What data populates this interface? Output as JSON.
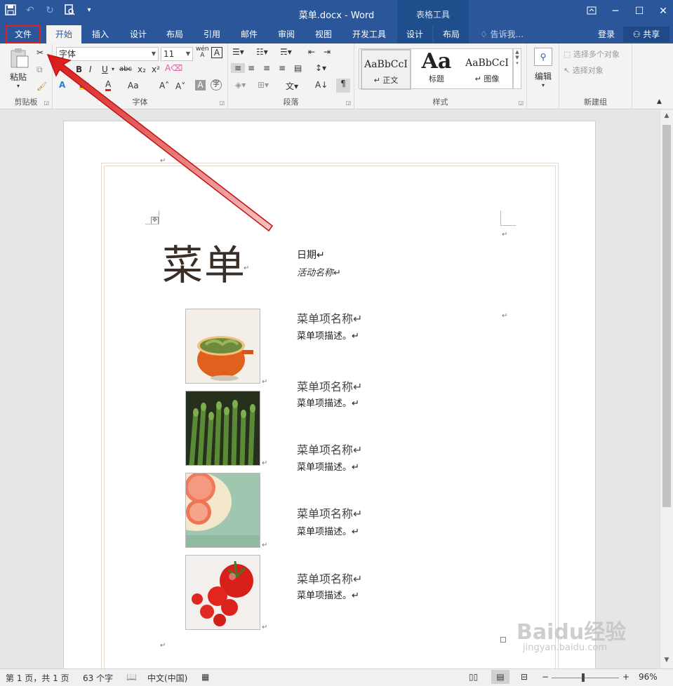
{
  "window": {
    "title": "菜单.docx - Word",
    "context_tab_group": "表格工具"
  },
  "qat": {
    "save_icon": "save-icon",
    "undo_icon": "undo-icon",
    "redo_icon": "redo-icon",
    "preview_icon": "print-preview-icon"
  },
  "tabs": [
    {
      "label": "文件"
    },
    {
      "label": "开始"
    },
    {
      "label": "插入"
    },
    {
      "label": "设计"
    },
    {
      "label": "布局"
    },
    {
      "label": "引用"
    },
    {
      "label": "邮件"
    },
    {
      "label": "审阅"
    },
    {
      "label": "视图"
    },
    {
      "label": "开发工具"
    },
    {
      "label": "设计"
    },
    {
      "label": "布局"
    }
  ],
  "tellme": "告诉我...",
  "account": {
    "login": "登录",
    "share": "共享"
  },
  "ribbon": {
    "clipboard": {
      "paste": "粘贴",
      "label": "剪贴板"
    },
    "font": {
      "name": "字体",
      "size": "11",
      "label": "字体",
      "wen": "wén",
      "wen_char": "A"
    },
    "paragraph": {
      "label": "段落"
    },
    "styles": {
      "label": "样式",
      "items": [
        {
          "sample": "AaBbCcI",
          "name": "↵ 正文"
        },
        {
          "sample": "Aa",
          "name": "标题"
        },
        {
          "sample": "AaBbCcI",
          "name": "↵ 图像"
        }
      ]
    },
    "editing": {
      "label": "编辑"
    },
    "new_group": {
      "label": "新建组",
      "select_multiple": "选择多个对象",
      "select_objects": "选择对象"
    }
  },
  "document": {
    "title": "菜单",
    "date": "日期↵",
    "event": "活动名称↵",
    "items": [
      {
        "name": "菜单项名称↵",
        "desc": "菜单项描述。↵"
      },
      {
        "name": "菜单项名称↵",
        "desc": "菜单项描述。↵"
      },
      {
        "name": "菜单项名称↵",
        "desc": "菜单项描述。↵"
      },
      {
        "name": "菜单项名称↵",
        "desc": "菜单项描述。↵"
      },
      {
        "name": "菜单项名称↵",
        "desc": "菜单项描述。↵"
      }
    ]
  },
  "status": {
    "page": "第 1 页，共 1 页",
    "words": "63 个字",
    "language": "中文(中国)",
    "zoom": "96%"
  },
  "watermark": {
    "brand": "Baidu经验",
    "url": "jingyan.baidu.com"
  },
  "colors": {
    "titlebar": "#2b579a",
    "file_highlight": "#e02020",
    "arrow": "#e02020"
  }
}
